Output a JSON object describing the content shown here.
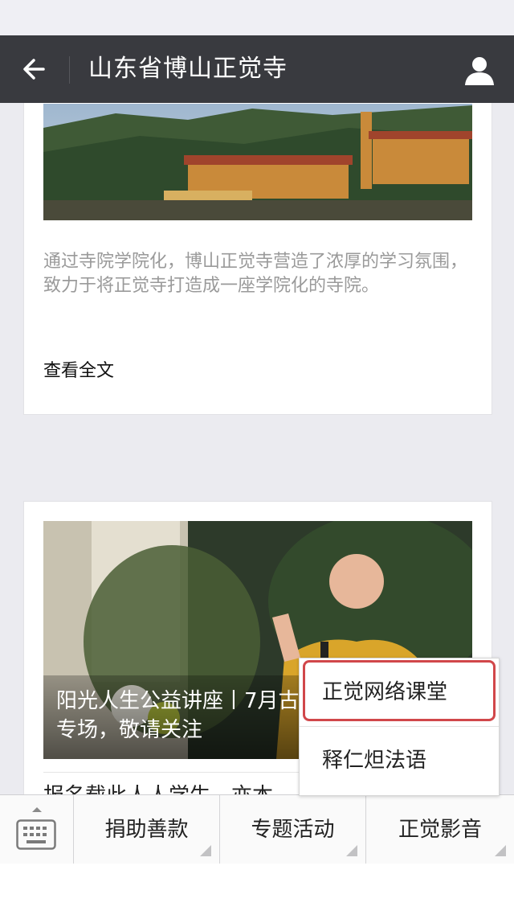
{
  "nav": {
    "title": "山东省博山正觉寺"
  },
  "article1": {
    "description": "通过寺院学院化，博山正觉寺营造了浓厚的学习氛围，致力于将正觉寺打造成一座学院化的寺院。",
    "read_more": "查看全文"
  },
  "article2": {
    "image_caption": "阳光人生公益讲座丨7月古寺专场，敬请关注",
    "title_partial": "报名载此人人学生，亦本"
  },
  "popup": {
    "items": [
      "正觉网络课堂",
      "释仁炟法语"
    ]
  },
  "menu": {
    "items": [
      "捐助善款",
      "专题活动",
      "正觉影音"
    ]
  },
  "colors": {
    "nav_bg": "#393a3f",
    "highlight": "#d1474a",
    "page_bg": "#ebebf0"
  },
  "icons": [
    "back-arrow-icon",
    "user-icon",
    "keyboard-icon",
    "submenu-corner-icon"
  ]
}
